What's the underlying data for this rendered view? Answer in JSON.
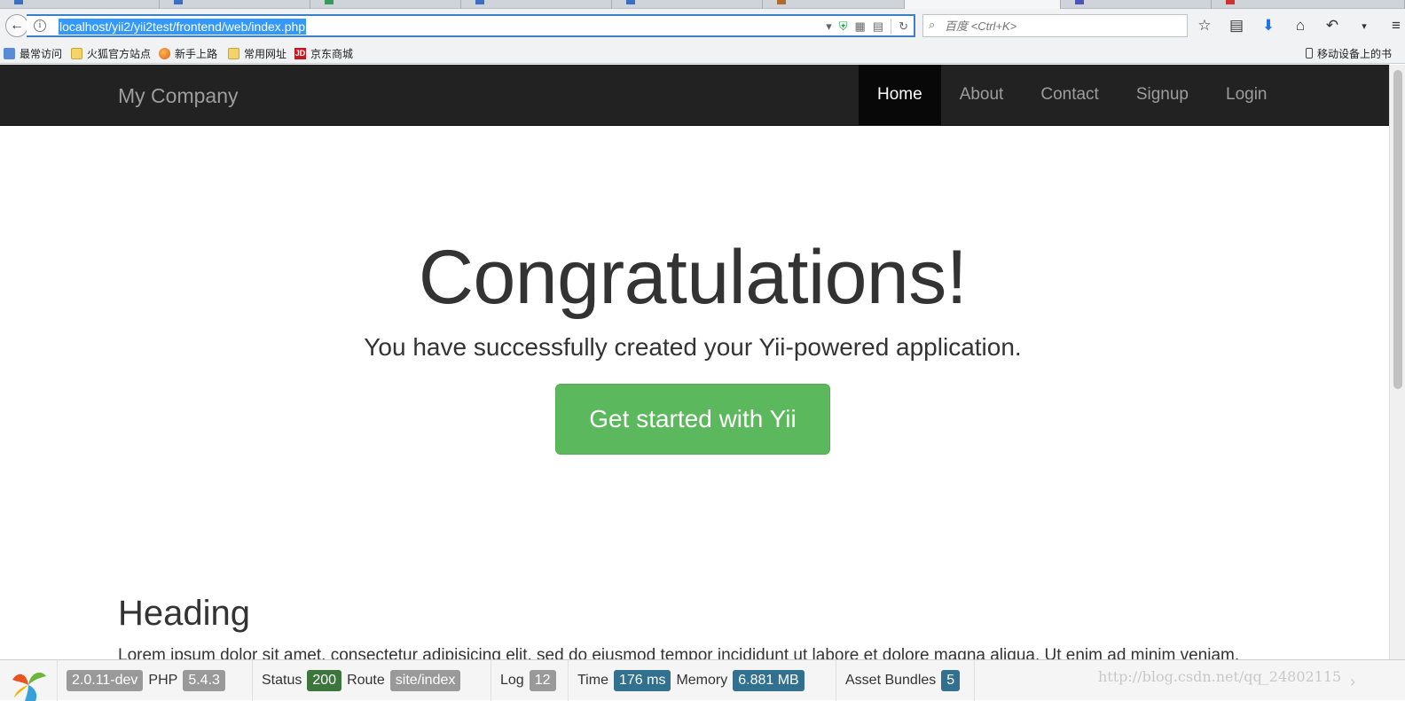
{
  "browser": {
    "address": {
      "url": "localhost/yii2/yii2test/frontend/web/index.php"
    },
    "search": {
      "placeholder": "百度 <Ctrl+K>"
    },
    "bookmarks": [
      {
        "label": "最常访问"
      },
      {
        "label": "火狐官方站点"
      },
      {
        "label": "新手上路"
      },
      {
        "label": "常用网址"
      },
      {
        "label": "京东商城"
      },
      {
        "label": "移动设备上的书"
      }
    ]
  },
  "site": {
    "brand": "My Company",
    "nav": [
      {
        "label": "Home",
        "active": true
      },
      {
        "label": "About"
      },
      {
        "label": "Contact"
      },
      {
        "label": "Signup"
      },
      {
        "label": "Login"
      }
    ],
    "jumbotron": {
      "title": "Congratulations!",
      "lead": "You have successfully created your Yii-powered application.",
      "button": "Get started with Yii"
    },
    "section": {
      "heading": "Heading",
      "text": "Lorem ipsum dolor sit amet, consectetur adipisicing elit, sed do eiusmod tempor incididunt ut labore et dolore magna aliqua. Ut enim ad minim veniam,"
    }
  },
  "debug": {
    "yii_version": "2.0.11-dev",
    "php_label": "PHP",
    "php_version": "5.4.3",
    "status_label": "Status",
    "status_code": "200",
    "route_label": "Route",
    "route": "site/index",
    "log_label": "Log",
    "log_count": "12",
    "time_label": "Time",
    "time": "176 ms",
    "memory_label": "Memory",
    "memory": "6.881 MB",
    "bundles_label": "Asset Bundles",
    "bundles": "5"
  },
  "watermark": "http://blog.csdn.net/qq_24802115",
  "colors": {
    "success": "#5cb85c",
    "navbar": "#222222",
    "label_blue": "#31708f",
    "label_green": "#3c763d"
  }
}
